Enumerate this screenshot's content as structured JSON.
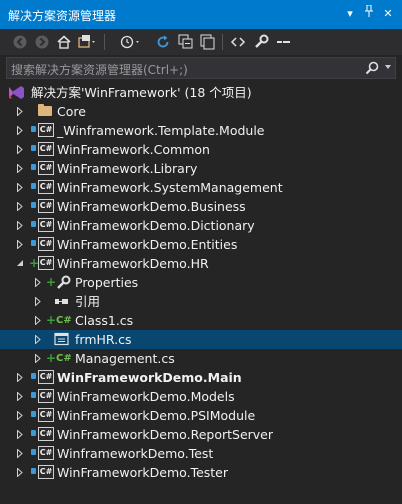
{
  "window": {
    "title": "解决方案资源管理器",
    "pin_glyph": "▾",
    "autohide_glyph": "⊣",
    "close_glyph": "✕"
  },
  "search": {
    "placeholder": "搜索解决方案资源管理器(Ctrl+;)"
  },
  "solution": {
    "label": "解决方案'WinFramework' (18 个项目)"
  },
  "tree": [
    {
      "label": "Core",
      "type": "folder",
      "expanded": false
    },
    {
      "label": "_Winframework.Template.Module",
      "type": "project"
    },
    {
      "label": "WinFramework.Common",
      "type": "project"
    },
    {
      "label": "WinFramework.Library",
      "type": "project"
    },
    {
      "label": "WinFramework.SystemManagement",
      "type": "project"
    },
    {
      "label": "WinFrameworkDemo.Business",
      "type": "project"
    },
    {
      "label": "WinFrameworkDemo.Dictionary",
      "type": "project"
    },
    {
      "label": "WinFrameworkDemo.Entities",
      "type": "project"
    },
    {
      "label": "WinFrameworkDemo.HR",
      "type": "project",
      "expanded": true
    },
    {
      "label": "Properties",
      "type": "properties"
    },
    {
      "label": "引用",
      "type": "references"
    },
    {
      "label": "Class1.cs",
      "type": "csfile"
    },
    {
      "label": "frmHR.cs",
      "type": "form",
      "selected": true
    },
    {
      "label": "Management.cs",
      "type": "csfile"
    },
    {
      "label": "WinFrameworkDemo.Main",
      "type": "project",
      "bold": true
    },
    {
      "label": "WinFrameworkDemo.Models",
      "type": "project"
    },
    {
      "label": "WinFrameworkDemo.PSIModule",
      "type": "project"
    },
    {
      "label": "WinFrameworkDemo.ReportServer",
      "type": "project"
    },
    {
      "label": "WinframeworkDemo.Test",
      "type": "project"
    },
    {
      "label": "WinFrameworkDemo.Tester",
      "type": "project"
    }
  ],
  "colors": {
    "accent": "#007acc",
    "background": "#252526",
    "selected": "#094771"
  }
}
